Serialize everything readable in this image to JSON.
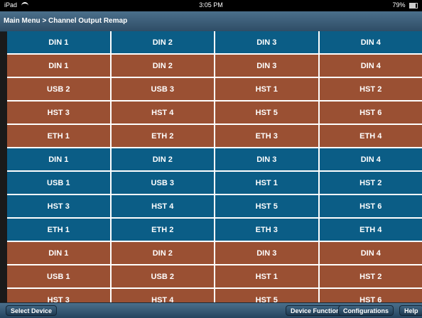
{
  "status_bar": {
    "left": "iPad",
    "time": "3:05 PM",
    "battery": "79%"
  },
  "nav": {
    "breadcrumb": "Main Menu > Channel Output Remap"
  },
  "grid": {
    "rows": [
      {
        "color": "#0b5d86",
        "cells": [
          "DIN 1",
          "DIN 2",
          "DIN 3",
          "DIN 4"
        ]
      },
      {
        "color": "#9a5033",
        "cells": [
          "DIN 1",
          "DIN 2",
          "DIN 3",
          "DIN 4"
        ]
      },
      {
        "color": "#9a5033",
        "cells": [
          "USB 2",
          "USB 3",
          "HST 1",
          "HST 2"
        ]
      },
      {
        "color": "#9a5033",
        "cells": [
          "HST 3",
          "HST 4",
          "HST 5",
          "HST 6"
        ]
      },
      {
        "color": "#9a5033",
        "cells": [
          "ETH 1",
          "ETH 2",
          "ETH 3",
          "ETH 4"
        ]
      },
      {
        "color": "#0b5d86",
        "cells": [
          "DIN 1",
          "DIN 2",
          "DIN 3",
          "DIN 4"
        ]
      },
      {
        "color": "#0b5d86",
        "cells": [
          "USB 1",
          "USB 3",
          "HST 1",
          "HST 2"
        ]
      },
      {
        "color": "#0b5d86",
        "cells": [
          "HST 3",
          "HST 4",
          "HST 5",
          "HST 6"
        ]
      },
      {
        "color": "#0b5d86",
        "cells": [
          "ETH 1",
          "ETH 2",
          "ETH 3",
          "ETH 4"
        ]
      },
      {
        "color": "#9a5033",
        "cells": [
          "DIN 1",
          "DIN 2",
          "DIN 3",
          "DIN 4"
        ]
      },
      {
        "color": "#9a5033",
        "cells": [
          "USB 1",
          "USB 2",
          "HST 1",
          "HST 2"
        ]
      },
      {
        "color": "#9a5033",
        "cells": [
          "HST 3",
          "HST 4",
          "HST 5",
          "HST 6"
        ]
      }
    ]
  },
  "toolbar": {
    "select_device": "Select Device",
    "device_functions": "Device Functions",
    "configurations": "Configurations",
    "help": "Help"
  }
}
